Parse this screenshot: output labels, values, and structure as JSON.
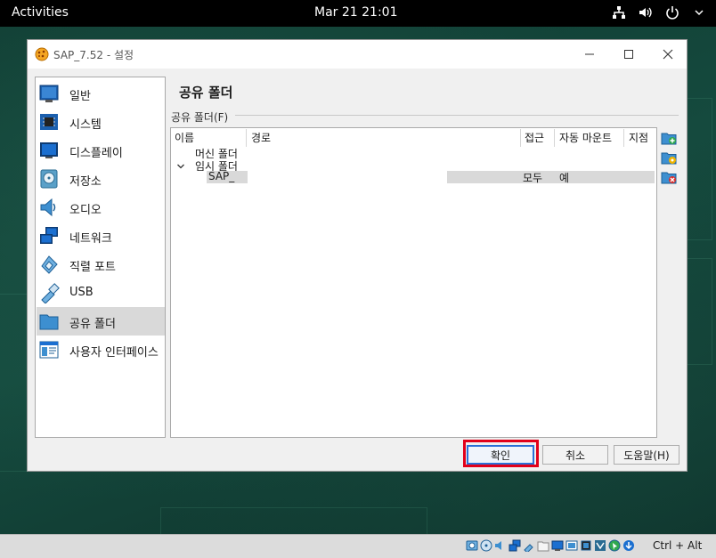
{
  "topbar": {
    "activities": "Activities",
    "clock": "Mar 21  21:01",
    "tray_icons": [
      "network-icon",
      "volume-icon",
      "power-icon"
    ]
  },
  "window": {
    "title": "SAP_7.52 - 설정",
    "controls": [
      "minimize",
      "maximize",
      "close"
    ]
  },
  "sidebar": {
    "items": [
      {
        "label": "일반",
        "icon": "general-icon"
      },
      {
        "label": "시스템",
        "icon": "system-icon"
      },
      {
        "label": "디스플레이",
        "icon": "display-icon"
      },
      {
        "label": "저장소",
        "icon": "storage-icon"
      },
      {
        "label": "오디오",
        "icon": "audio-icon"
      },
      {
        "label": "네트워크",
        "icon": "network-icon"
      },
      {
        "label": "직렬 포트",
        "icon": "serial-port-icon"
      },
      {
        "label": "USB",
        "icon": "usb-icon"
      },
      {
        "label": "공유 폴더",
        "icon": "shared-folder-icon",
        "selected": true
      },
      {
        "label": "사용자 인터페이스",
        "icon": "user-interface-icon"
      }
    ]
  },
  "main": {
    "section_title": "공유 폴더",
    "group_label": "공유 폴더(F)",
    "columns": [
      "이름",
      "경로",
      "접근",
      "자동 마운트",
      "지점"
    ],
    "tree": {
      "machine_folders": "머신 폴더",
      "transient_folders": "임시 폴더",
      "rows": [
        {
          "name": "SAP_",
          "path": "",
          "access": "모두",
          "auto_mount": "예",
          "point": ""
        }
      ]
    },
    "tools": [
      "add-shared-folder-icon",
      "edit-shared-folder-icon",
      "remove-shared-folder-icon"
    ]
  },
  "buttons": {
    "ok": "확인",
    "cancel": "취소",
    "help": "도움말(H)"
  },
  "statusbar": {
    "host_key": "Ctrl + Alt"
  },
  "colors": {
    "accent": "#2b6fd6",
    "highlight": "#e2001a",
    "selected_bg": "#d9d9d9"
  }
}
